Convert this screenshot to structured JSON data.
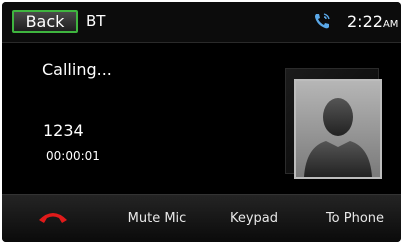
{
  "header": {
    "back_label": "Back",
    "source_label": "BT",
    "time": "2:22",
    "time_suffix": "AM"
  },
  "call": {
    "status": "Calling...",
    "number": "1234",
    "duration": "00:00:01"
  },
  "actions": {
    "mute_label": "Mute Mic",
    "keypad_label": "Keypad",
    "to_phone_label": "To Phone"
  },
  "icons": {
    "call_status": "phone-icon",
    "end_call": "end-call-icon",
    "avatar": "contact-placeholder-icon"
  },
  "colors": {
    "accent_green": "#3fb53f",
    "end_call_red": "#e01a1a",
    "call_icon_blue": "#5aa8e8"
  }
}
